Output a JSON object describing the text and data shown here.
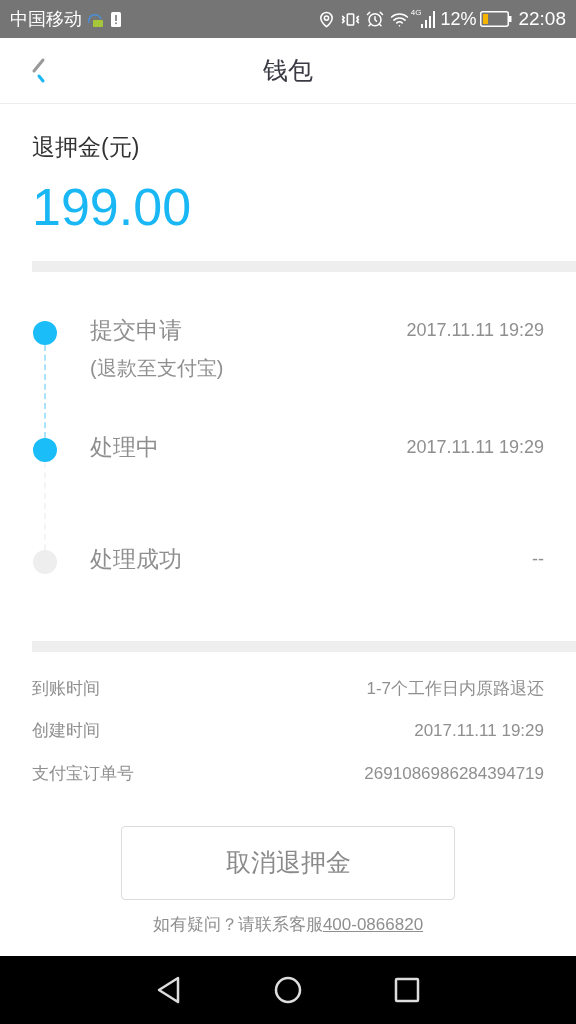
{
  "status_bar": {
    "carrier": "中国移动",
    "network": "4G",
    "battery": "12%",
    "time": "22:08"
  },
  "header": {
    "title": "钱包"
  },
  "deposit": {
    "label": "退押金(元)",
    "amount": "199.00"
  },
  "timeline": [
    {
      "title": "提交申请",
      "note": "(退款至支付宝)",
      "time": "2017.11.11 19:29",
      "done": true
    },
    {
      "title": "处理中",
      "time": "2017.11.11 19:29",
      "done": true
    },
    {
      "title": "处理成功",
      "time": "--",
      "done": false
    }
  ],
  "details": [
    {
      "label": "到账时间",
      "value": "1-7个工作日内原路退还"
    },
    {
      "label": "创建时间",
      "value": "2017.11.11 19:29"
    },
    {
      "label": "支付宝订单号",
      "value": "2691086986284394719"
    }
  ],
  "cancel_button": "取消退押金",
  "help": {
    "text": "如有疑问？请联系客服",
    "phone": "400-0866820"
  }
}
